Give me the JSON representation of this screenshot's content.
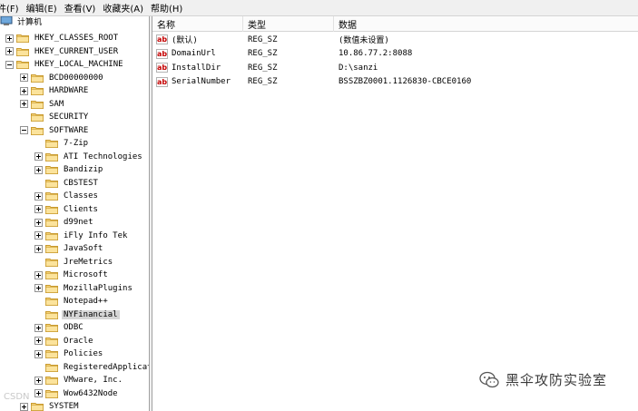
{
  "menubar": {
    "items": [
      "件(F)",
      "编辑(E)",
      "查看(V)",
      "收藏夹(A)",
      "帮助(H)"
    ]
  },
  "tree": {
    "root_label": "计算机",
    "nodes": [
      {
        "label": "HKEY_CLASSES_ROOT",
        "depth": 1,
        "expander": "plus",
        "selected": false
      },
      {
        "label": "HKEY_CURRENT_USER",
        "depth": 1,
        "expander": "plus",
        "selected": false
      },
      {
        "label": "HKEY_LOCAL_MACHINE",
        "depth": 1,
        "expander": "minus",
        "selected": false
      },
      {
        "label": "BCD00000000",
        "depth": 2,
        "expander": "plus",
        "selected": false
      },
      {
        "label": "HARDWARE",
        "depth": 2,
        "expander": "plus",
        "selected": false
      },
      {
        "label": "SAM",
        "depth": 2,
        "expander": "plus",
        "selected": false
      },
      {
        "label": "SECURITY",
        "depth": 2,
        "expander": "none",
        "selected": false
      },
      {
        "label": "SOFTWARE",
        "depth": 2,
        "expander": "minus",
        "selected": false
      },
      {
        "label": "7-Zip",
        "depth": 3,
        "expander": "none",
        "selected": false
      },
      {
        "label": "ATI Technologies",
        "depth": 3,
        "expander": "plus",
        "selected": false
      },
      {
        "label": "Bandizip",
        "depth": 3,
        "expander": "plus",
        "selected": false
      },
      {
        "label": "CBSTEST",
        "depth": 3,
        "expander": "none",
        "selected": false
      },
      {
        "label": "Classes",
        "depth": 3,
        "expander": "plus",
        "selected": false
      },
      {
        "label": "Clients",
        "depth": 3,
        "expander": "plus",
        "selected": false
      },
      {
        "label": "d99net",
        "depth": 3,
        "expander": "plus",
        "selected": false
      },
      {
        "label": "iFly Info Tek",
        "depth": 3,
        "expander": "plus",
        "selected": false
      },
      {
        "label": "JavaSoft",
        "depth": 3,
        "expander": "plus",
        "selected": false
      },
      {
        "label": "JreMetrics",
        "depth": 3,
        "expander": "none",
        "selected": false
      },
      {
        "label": "Microsoft",
        "depth": 3,
        "expander": "plus",
        "selected": false
      },
      {
        "label": "MozillaPlugins",
        "depth": 3,
        "expander": "plus",
        "selected": false
      },
      {
        "label": "Notepad++",
        "depth": 3,
        "expander": "none",
        "selected": false
      },
      {
        "label": "NYFinancial",
        "depth": 3,
        "expander": "none",
        "selected": true
      },
      {
        "label": "ODBC",
        "depth": 3,
        "expander": "plus",
        "selected": false
      },
      {
        "label": "Oracle",
        "depth": 3,
        "expander": "plus",
        "selected": false
      },
      {
        "label": "Policies",
        "depth": 3,
        "expander": "plus",
        "selected": false
      },
      {
        "label": "RegisteredApplicati",
        "depth": 3,
        "expander": "none",
        "selected": false
      },
      {
        "label": "VMware, Inc.",
        "depth": 3,
        "expander": "plus",
        "selected": false
      },
      {
        "label": "Wow6432Node",
        "depth": 3,
        "expander": "plus",
        "selected": false
      },
      {
        "label": "SYSTEM",
        "depth": 2,
        "expander": "plus",
        "selected": false
      }
    ]
  },
  "values": {
    "columns": [
      "名称",
      "类型",
      "数据"
    ],
    "rows": [
      {
        "name": "(默认)",
        "type": "REG_SZ",
        "data": "(数值未设置)"
      },
      {
        "name": "DomainUrl",
        "type": "REG_SZ",
        "data": "10.86.77.2:8088"
      },
      {
        "name": "InstallDir",
        "type": "REG_SZ",
        "data": "D:\\sanzi"
      },
      {
        "name": "SerialNumber",
        "type": "REG_SZ",
        "data": "BSSZBZ0001.1126830-CBCE0160"
      }
    ]
  },
  "icons": {
    "folder": "folder-icon",
    "computer": "computer-icon",
    "string_value": "ab-string-icon",
    "wechat": "wechat-icon"
  },
  "colors": {
    "folder_fill": "#f5d37a",
    "folder_edge": "#c99a2e",
    "selection": "#d6d6d6",
    "string_icon_red": "#c40000"
  },
  "watermark": {
    "text": "黑伞攻防实验室",
    "corner_mark": "CSDN"
  }
}
